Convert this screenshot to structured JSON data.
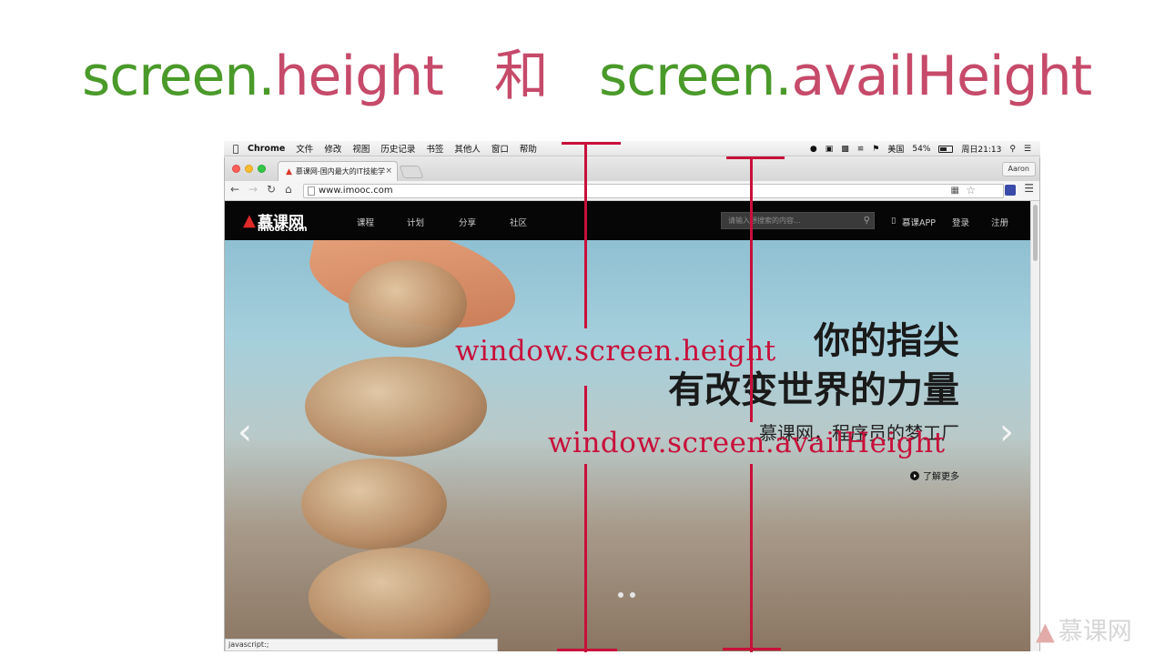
{
  "slide": {
    "title_part1": "screen.height",
    "title_conj": "和",
    "title_part2_green": "screen.",
    "title_part2_red": "availHeight",
    "title_part1_green": "screen.",
    "title_part1_red": "height",
    "brand": "慕课网"
  },
  "menubar": {
    "app": "Chrome",
    "items": [
      "文件",
      "修改",
      "视图",
      "历史记录",
      "书签",
      "其他人",
      "窗口",
      "帮助"
    ],
    "input_method": "美国",
    "battery": "54%",
    "clock": "周日21:13"
  },
  "browser": {
    "tab_title": "慕课网-国内最大的IT技能学",
    "tab_close": "×",
    "profile": "Aaron",
    "url": "www.imooc.com",
    "status_text": "javascript:;"
  },
  "site": {
    "logo_cn": "慕课网",
    "logo_en": "imooc.com",
    "nav": [
      "课程",
      "计划",
      "分享",
      "社区"
    ],
    "search_placeholder": "请输入想搜索的内容...",
    "app_link": "慕课APP",
    "login": "登录",
    "register": "注册",
    "hero_line1": "你的指尖",
    "hero_line2": "有改变世界的力量",
    "hero_sub": "慕课网，程序员的梦工厂",
    "hero_more": "了解更多",
    "prev_arrow": "‹",
    "next_arrow": "›"
  },
  "annotations": {
    "height_label": "window.screen.height",
    "avail_label": "window.screen.availHeight"
  },
  "colors": {
    "title_green": "#4a9a2a",
    "title_red": "#c64a6a",
    "annotation_red": "#c8103a",
    "site_nav_bg": "#060606"
  }
}
